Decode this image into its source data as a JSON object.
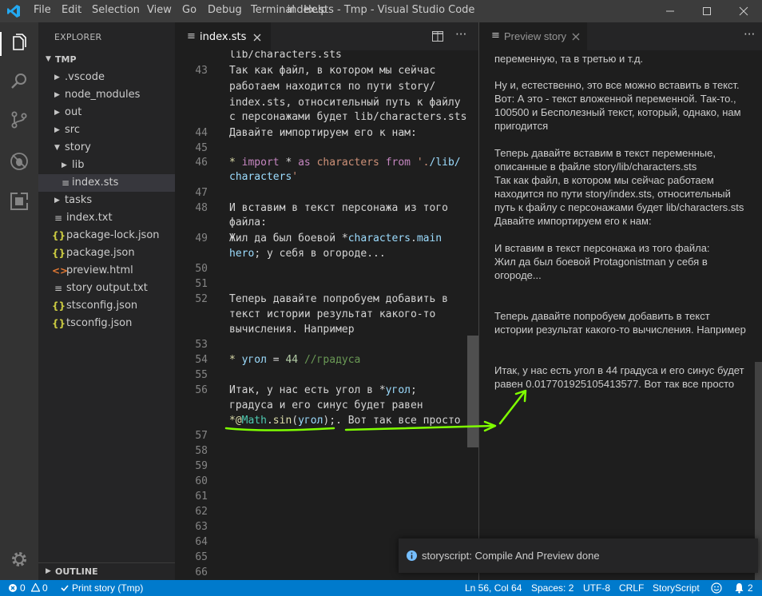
{
  "window": {
    "menu": [
      "File",
      "Edit",
      "Selection",
      "View",
      "Go",
      "Debug",
      "Terminal",
      "Help"
    ],
    "title": "index.sts - Tmp - Visual Studio Code"
  },
  "sidebar": {
    "title": "EXPLORER",
    "folder": "TMP",
    "items": [
      {
        "label": ".vscode",
        "kind": "folder",
        "expanded": false
      },
      {
        "label": "node_modules",
        "kind": "folder",
        "expanded": false
      },
      {
        "label": "out",
        "kind": "folder",
        "expanded": false
      },
      {
        "label": "src",
        "kind": "folder",
        "expanded": false
      },
      {
        "label": "story",
        "kind": "folder",
        "expanded": true
      },
      {
        "label": "lib",
        "kind": "folder",
        "expanded": false
      },
      {
        "label": "index.sts",
        "kind": "file",
        "icon": "lines-icon"
      },
      {
        "label": "tasks",
        "kind": "folder",
        "expanded": false
      },
      {
        "label": "index.txt",
        "kind": "file",
        "icon": "lines-icon"
      },
      {
        "label": "package-lock.json",
        "kind": "file",
        "icon": "json-icon"
      },
      {
        "label": "package.json",
        "kind": "file",
        "icon": "json-icon"
      },
      {
        "label": "preview.html",
        "kind": "file",
        "icon": "html-icon"
      },
      {
        "label": "story output.txt",
        "kind": "file",
        "icon": "lines-icon"
      },
      {
        "label": "stsconfig.json",
        "kind": "file",
        "icon": "json-icon"
      },
      {
        "label": "tsconfig.json",
        "kind": "file",
        "icon": "json-icon"
      }
    ],
    "outline": "OUTLINE"
  },
  "editor": {
    "tab": "index.sts",
    "lines": {
      "l43": "43",
      "l44": "44",
      "l45": "45",
      "l46": "46",
      "l47": "47",
      "l48": "48",
      "l49": "49",
      "l50": "50",
      "l51": "51",
      "l52": "52",
      "l53": "53",
      "l54": "54",
      "l55": "55",
      "l56": "56",
      "l57": "57",
      "l58": "58",
      "l59": "59",
      "l60": "60",
      "l61": "61",
      "l62": "62",
      "l63": "63",
      "l64": "64",
      "l65": "65",
      "l66": "66"
    },
    "code": {
      "c0": "lib/characters.sts",
      "c1": "Так как файл, в котором мы сейчас",
      "c2": "работаем находится по пути story/",
      "c3": "index.sts, относительный путь к файлу",
      "c4": "с персонажами будет lib/characters.sts",
      "c5": "Давайте импортируем его к нам:",
      "c46a": "* ",
      "c46b": "import",
      "c46c": " * ",
      "c46d": "as",
      "c46e": " ",
      "c46f": "characters",
      "c46g": " ",
      "c46h": "from",
      "c46i": " '.",
      "c46j": "/lib/",
      "c46k": "characters",
      "c46l": "'",
      "c48a": "И вставим в текст персонажа из того",
      "c48b": "файла:",
      "c49a": "Жил да был боевой *",
      "c49b": "characters",
      "c49c": ".",
      "c49d": "main",
      "c49e": "hero",
      "c49f": "; у себя в огороде...",
      "c52a": "Теперь давайте попробуем добавить в",
      "c52b": "текст истории результат какого-то",
      "c52c": "вычисления. Например",
      "c54a": "* ",
      "c54b": "угол",
      "c54c": " = ",
      "c54d": "44",
      "c54e": " ",
      "c54f": "//градуса",
      "c56a": "Итак, у нас есть угол в *",
      "c56b": "угол",
      "c56c": ";",
      "c56d": "градуса и его синус будет равен",
      "c56e": "*@",
      "c56f": "Math",
      "c56g": ".",
      "c56h": "sin",
      "c56i": "(",
      "c56j": "угол",
      "c56k": ");",
      "c56l": ". Вот так все просто"
    }
  },
  "preview": {
    "tab": "Preview story",
    "p0": "переменную, та в третью и т.д.",
    "p1": "Ну и, естественно, это все можно вставить в текст. Вот: А это - текст вложенной переменной. Так-то., 100500 и Бесполезный текст, который, однако, нам пригодится",
    "p2": "Теперь давайте вставим в текст переменные, описанные в файле story/lib/characters.sts",
    "p3": "Так как файл, в котором мы сейчас работаем находится по пути story/index.sts, относительный путь к файлу с персонажами будет lib/characters.sts",
    "p4": "Давайте импортируем его к нам:",
    "p5": "И вставим в текст персонажа из того файла:",
    "p6": "Жил да был боевой Protagonistman у себя в огороде...",
    "p7": "Теперь давайте попробуем добавить в текст истории результат какого-то вычисления. Например",
    "p8": "Итак, у нас есть угол в 44 градуса и его синус будет равен 0.017701925105413577. Вот так все просто"
  },
  "notification": {
    "text": "storyscript: Compile And Preview done"
  },
  "statusbar": {
    "errors": "0",
    "warnings": "0",
    "task": "Print story (Tmp)",
    "position": "Ln 56, Col 64",
    "spaces": "Spaces: 2",
    "encoding": "UTF-8",
    "eol": "CRLF",
    "language": "StoryScript",
    "notifications": "2"
  },
  "colors": {
    "statusbar": "#007acc",
    "annotation": "#7fff00"
  }
}
